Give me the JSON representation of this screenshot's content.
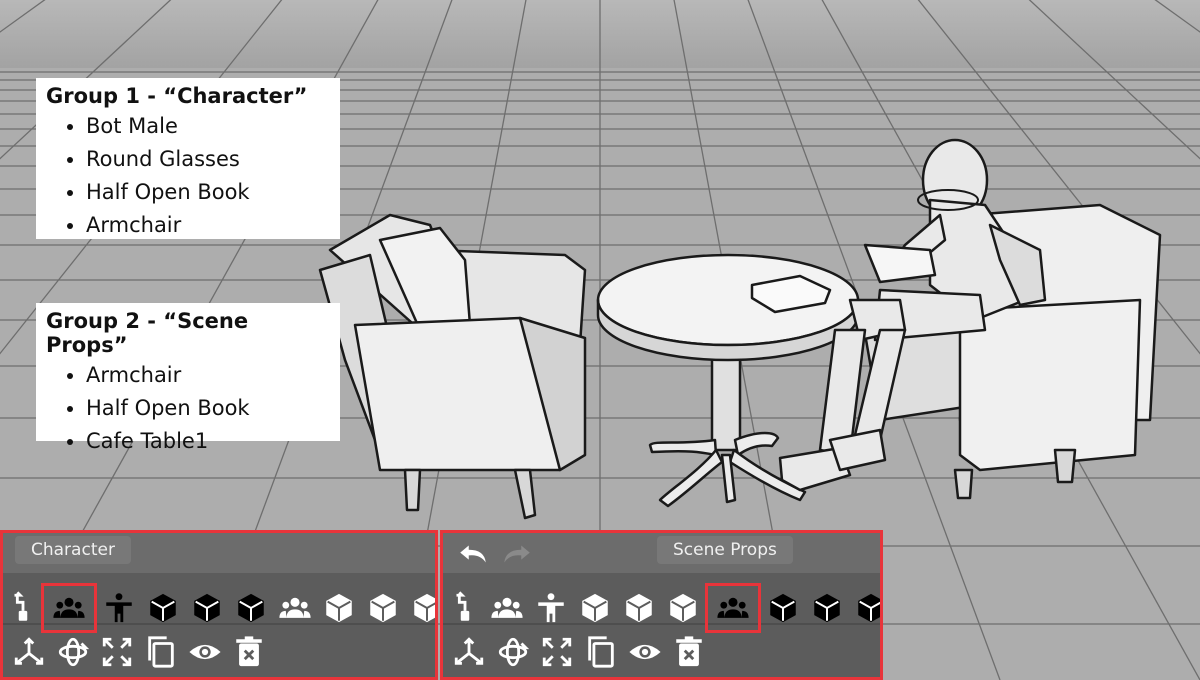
{
  "annotations": {
    "group1": {
      "title": "Group 1 - “Character”",
      "items": [
        "Bot Male",
        "Round Glasses",
        "Half Open Book",
        "Armchair"
      ]
    },
    "group2": {
      "title": "Group 2 - “Scene Props”",
      "items": [
        "Armchair",
        "Half Open Book",
        "Cafe Table1"
      ]
    }
  },
  "left_panel": {
    "group_label": "Character",
    "toolbar_icons": [
      "pose-tool-icon",
      "group-icon",
      "character-icon",
      "object-dark-icon",
      "object-dark-icon",
      "object-dark-icon",
      "group-icon",
      "object-light-icon",
      "object-light-icon",
      "object-light-icon"
    ],
    "highlighted_icon": "group-icon"
  },
  "right_panel": {
    "group_label": "Scene Props",
    "toolbar_icons": [
      "pose-tool-icon",
      "group-icon",
      "character-icon",
      "object-light-icon",
      "object-light-icon",
      "object-light-icon",
      "group-icon",
      "object-dark-icon",
      "object-dark-icon",
      "object-dark-icon"
    ],
    "highlighted_icon": "group-icon"
  },
  "action_icons": [
    "move-icon",
    "rotate-icon",
    "scale-icon",
    "duplicate-icon",
    "visibility-icon",
    "delete-icon"
  ],
  "colors": {
    "highlight": "#e8343a",
    "panel": "#5c5c5c",
    "floor": "#a9a9a9"
  }
}
